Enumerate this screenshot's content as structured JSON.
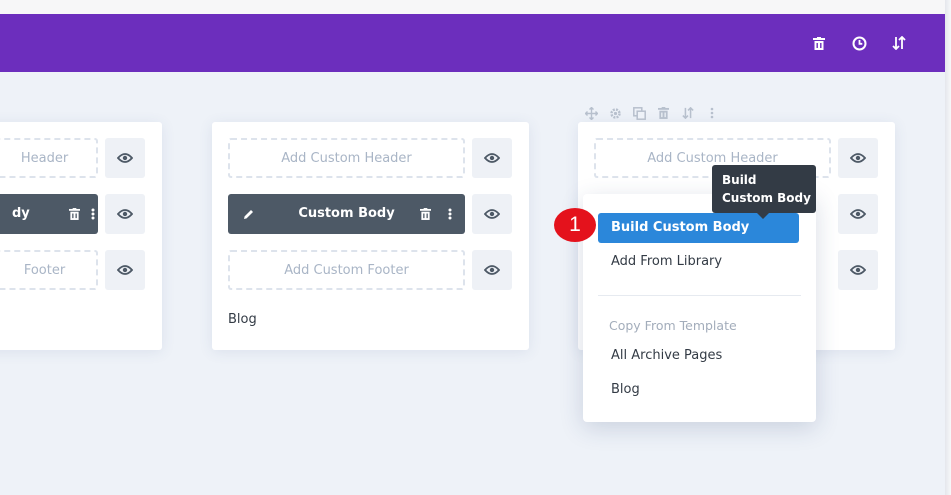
{
  "topbar": {
    "background": "#6c2ebd",
    "icons": [
      "trash-icon",
      "history-icon",
      "sort-icon"
    ]
  },
  "cards": [
    {
      "header_label": "Header",
      "body_label": "dy",
      "footer_label": "Footer",
      "title": ""
    },
    {
      "header_label": "Add Custom Header",
      "body_label": "Custom Body",
      "footer_label": "Add Custom Footer",
      "title": "Blog"
    },
    {
      "header_label": "Add Custom Header",
      "title": ""
    }
  ],
  "mini_toolbar_icons": [
    "move-icon",
    "settings-icon",
    "duplicate-icon",
    "trash-icon",
    "sort-icon",
    "more-icon"
  ],
  "dropdown": {
    "items": [
      "Build Custom Body",
      "Add From Library"
    ],
    "section_label": "Copy From Template",
    "template_items": [
      "All Archive Pages",
      "Blog"
    ]
  },
  "tooltip": {
    "line1": "Build",
    "line2": "Custom Body"
  },
  "step_badge": "1",
  "colors": {
    "accent": "#2b87da",
    "topbar": "#6c2ebd",
    "body_bar": "#4d5966",
    "badge": "#e4121c"
  }
}
